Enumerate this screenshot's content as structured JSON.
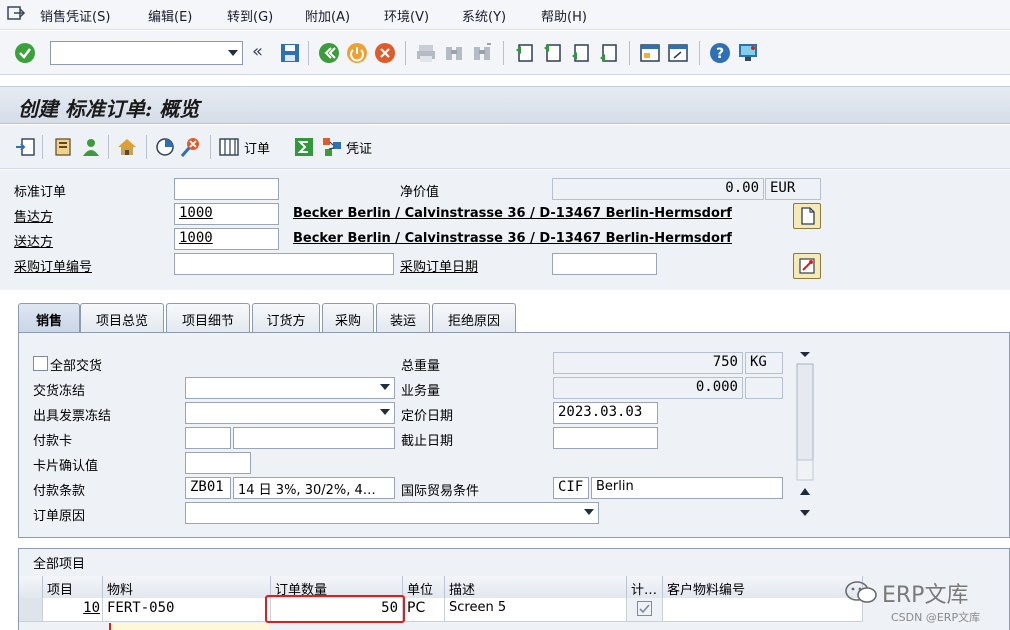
{
  "menu": {
    "items": [
      {
        "label": "销售凭证(S)"
      },
      {
        "label": "编辑(E)"
      },
      {
        "label": "转到(G)"
      },
      {
        "label": "附加(A)"
      },
      {
        "label": "环境(V)"
      },
      {
        "label": "系统(Y)"
      },
      {
        "label": "帮助(H)"
      }
    ]
  },
  "title": "创建 标准订单: 概览",
  "app_toolbar": {
    "order_label": "订单",
    "doc_label": "凭证"
  },
  "header": {
    "std_order_label": "标准订单",
    "std_order_value": "",
    "net_value_label": "净价值",
    "net_value": "0.00",
    "currency": "EUR",
    "sold_to_label": "售达方",
    "sold_to_value": "1000",
    "sold_to_desc": "Becker Berlin / Calvinstrasse 36 / D-13467 Berlin-Hermsdorf",
    "ship_to_label": "送达方",
    "ship_to_value": "1000",
    "ship_to_desc": "Becker Berlin / Calvinstrasse 36 / D-13467 Berlin-Hermsdorf",
    "po_number_label": "采购订单编号",
    "po_number_value": "",
    "po_date_label": "采购订单日期",
    "po_date_value": ""
  },
  "tabs": [
    {
      "label": "销售"
    },
    {
      "label": "项目总览"
    },
    {
      "label": "项目细节"
    },
    {
      "label": "订货方"
    },
    {
      "label": "采购"
    },
    {
      "label": "装运"
    },
    {
      "label": "拒绝原因"
    }
  ],
  "sales_tab": {
    "complete_delivery_label": "全部交货",
    "delivery_block_label": "交货冻结",
    "billing_block_label": "出具发票冻结",
    "payment_card_label": "付款卡",
    "card_verify_label": "卡片确认值",
    "payment_terms_label": "付款条款",
    "payment_terms_code": "ZB01",
    "payment_terms_desc": "14 日 3%, 30/2%, 4…",
    "order_reason_label": "订单原因",
    "total_weight_label": "总重量",
    "total_weight_value": "750",
    "weight_unit": "KG",
    "volume_label": "业务量",
    "volume_value": "0.000",
    "pricing_date_label": "定价日期",
    "pricing_date_value": "2023.03.03",
    "cutoff_date_label": "截止日期",
    "incoterms_label": "国际贸易条件",
    "incoterms_code": "CIF",
    "incoterms_place": "Berlin"
  },
  "items": {
    "section_title": "全部项目",
    "columns": [
      "项目",
      "物料",
      "订单数量",
      "单位",
      "描述",
      "计…",
      "客户物料编号"
    ],
    "rows": [
      {
        "item": "10",
        "material": "FERT-050",
        "qty": "50",
        "unit": "PC",
        "desc": "Screen 5"
      }
    ]
  },
  "watermark": {
    "brand": "ERP文库",
    "credit": "CSDN @ERP文库"
  },
  "colors": {
    "accent": "#2f6fb3",
    "highlight": "#e31b1b"
  }
}
